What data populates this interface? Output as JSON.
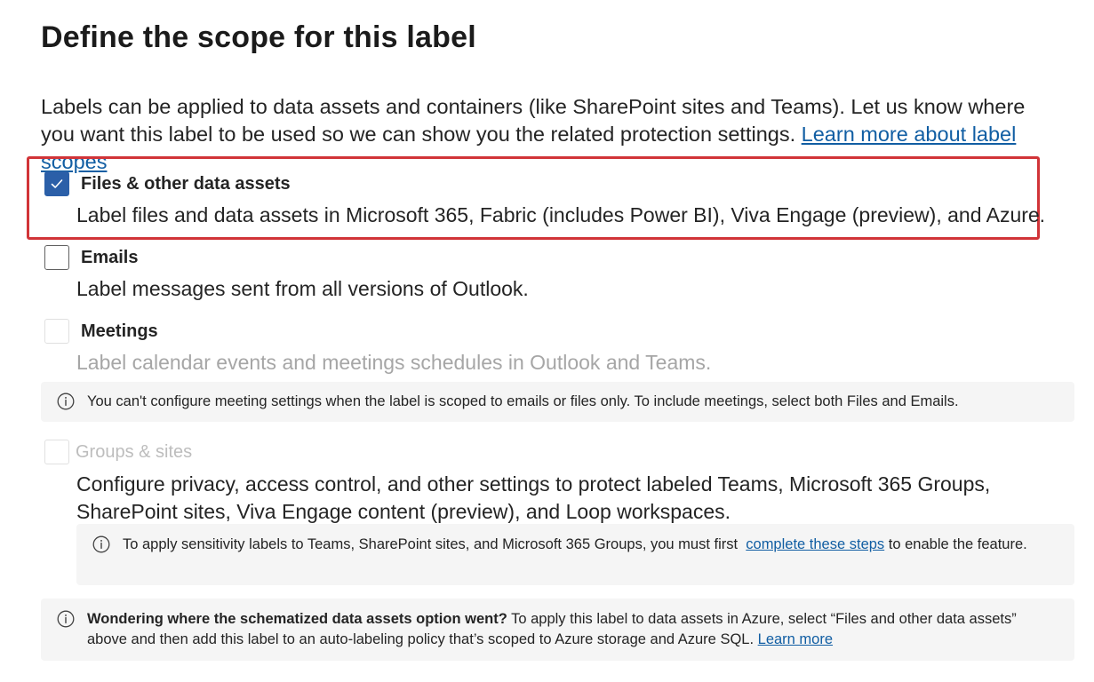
{
  "page": {
    "title": "Define the scope for this label",
    "intro_text": "Labels can be applied to data assets and containers (like SharePoint sites and Teams). Let us know where you want this label to be used so we can show you the related protection settings.",
    "intro_link": "Learn more about label scopes"
  },
  "options": {
    "files": {
      "title": "Files & other data assets",
      "description": "Label files and data assets in Microsoft 365, Fabric (includes Power BI), Viva Engage (preview), and Azure.",
      "checked": true
    },
    "emails": {
      "title": "Emails",
      "description": "Label messages sent from all versions of Outlook.",
      "checked": false
    },
    "meetings": {
      "title": "Meetings",
      "description": "Label calendar events and meetings schedules in Outlook and Teams.",
      "checked": false,
      "disabled": true
    },
    "groups": {
      "title": "Groups & sites",
      "description": "Configure privacy, access control, and other settings to protect labeled Teams, Microsoft 365 Groups, SharePoint sites, Viva Engage content (preview), and Loop workspaces.",
      "checked": false,
      "disabled": true
    }
  },
  "notices": {
    "meetings": "You can't configure meeting settings when the label is scoped to emails or files only. To include meetings, select both Files and Emails.",
    "groups_before": "To apply sensitivity labels to Teams, SharePoint sites, and Microsoft 365 Groups, you must first",
    "groups_link": "complete these steps",
    "groups_after": "to enable the feature.",
    "schematized_bold": "Wondering where the schematized data assets option went?",
    "schematized_text": "To apply this label to data assets in Azure, select “Files and other data assets” above and then add this label to an auto-labeling policy that’s scoped to Azure storage and Azure SQL.",
    "schematized_link": "Learn more"
  },
  "colors": {
    "accent": "#2b5fa8",
    "highlight": "#d13438",
    "link": "#115ea3",
    "info_bg": "#f5f5f5"
  },
  "icons": {
    "check": "check-icon",
    "info": "info-icon"
  }
}
